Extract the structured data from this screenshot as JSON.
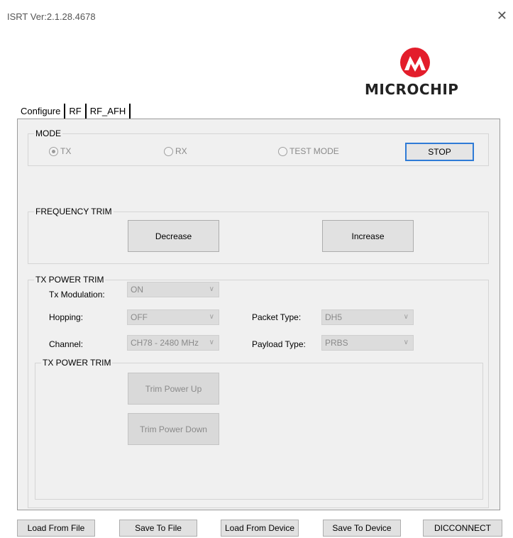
{
  "window": {
    "title": "ISRT Ver:2.1.28.4678",
    "close_glyph": "✕"
  },
  "logo": {
    "brand_text": "MICROCHIP",
    "brand_color": "#e31d2b"
  },
  "tabs": [
    {
      "label": "Configure"
    },
    {
      "label": "RF"
    },
    {
      "label": "RF_AFH"
    }
  ],
  "mode": {
    "label": "MODE",
    "options": [
      {
        "label": "TX",
        "checked": true
      },
      {
        "label": "RX",
        "checked": false
      },
      {
        "label": "TEST MODE",
        "checked": false
      }
    ],
    "stop_label": "STOP"
  },
  "frequency_trim": {
    "label": "FREQUENCY TRIM",
    "decrease_label": "Decrease",
    "increase_label": "Increase"
  },
  "tx_power_trim": {
    "label": "TX POWER TRIM",
    "tx_modulation": {
      "label": "Tx Modulation:",
      "value": "ON"
    },
    "hopping": {
      "label": "Hopping:",
      "value": "OFF"
    },
    "channel": {
      "label": "Channel:",
      "value": "CH78 - 2480 MHz"
    },
    "packet_type": {
      "label": "Packet Type:",
      "value": "DH5"
    },
    "payload_type": {
      "label": "Payload Type:",
      "value": "PRBS"
    },
    "inner": {
      "label": "TX POWER TRIM",
      "trim_up_label": "Trim Power Up",
      "trim_down_label": "Trim Power Down"
    }
  },
  "footer": {
    "load_file": "Load From File",
    "save_file": "Save To File",
    "load_device": "Load From Device",
    "save_device": "Save To Device",
    "disconnect": "DICCONNECT"
  },
  "colors": {
    "accent_focus": "#2f7bd6",
    "panel_bg": "#f0f0f0"
  }
}
